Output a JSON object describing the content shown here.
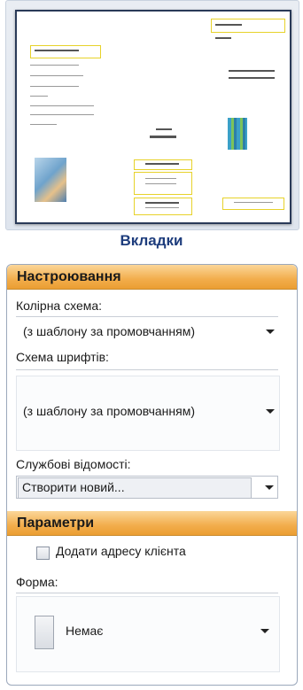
{
  "gallery": {
    "caption": "Вкладки"
  },
  "customize": {
    "header": "Настроювання",
    "color_scheme_label": "Колірна схема:",
    "color_scheme_value": "(з шаблону за промовчанням)",
    "font_scheme_label": "Схема шрифтів:",
    "font_scheme_value": "(з шаблону за промовчанням)",
    "business_info_label": "Службові відомості:",
    "business_info_value": "Створити новий..."
  },
  "options": {
    "header": "Параметри",
    "customer_address_label": "Додати адресу клієнта",
    "customer_address_checked": false,
    "form_label": "Форма:",
    "form_value": "Немає"
  }
}
